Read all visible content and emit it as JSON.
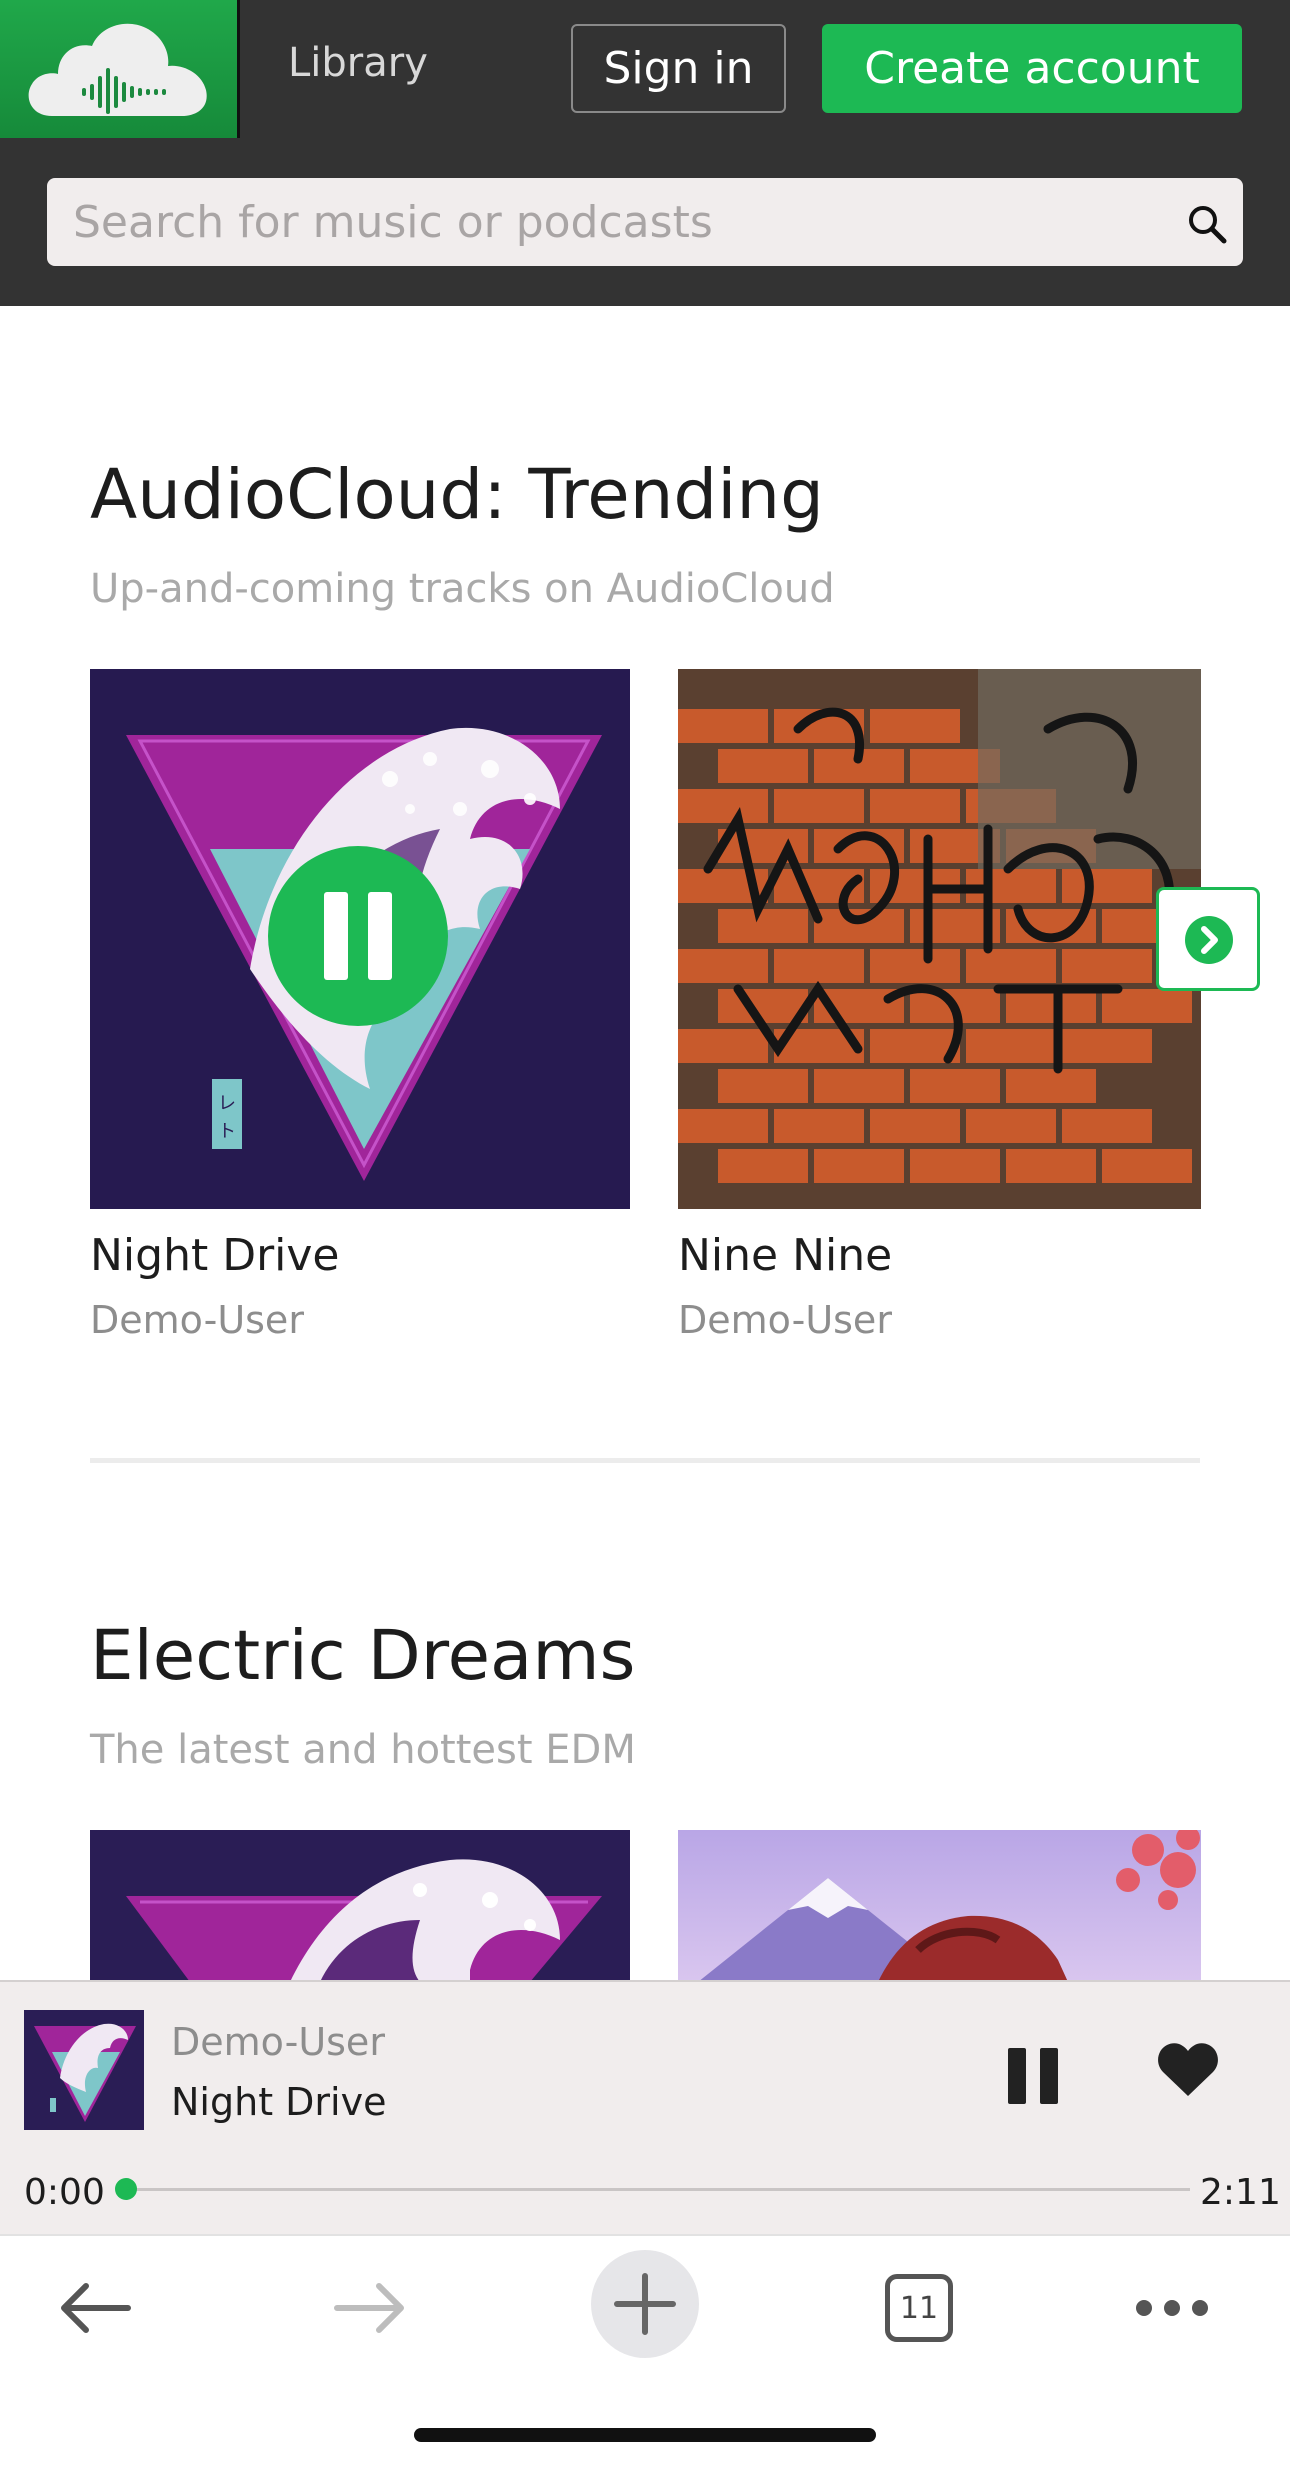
{
  "header": {
    "logo_name": "audiocloud-logo",
    "library_label": "Library",
    "signin_label": "Sign in",
    "create_account_label": "Create account",
    "search_placeholder": "Search for music or podcasts",
    "search_value": "",
    "search_icon": "search-icon"
  },
  "sections": [
    {
      "title": "AudioCloud: Trending",
      "subtitle": "Up-and-coming tracks on AudioCloud",
      "cards": [
        {
          "title": "Night Drive",
          "artist": "Demo-User",
          "art": "great-wave-triangle-artwork",
          "playing": true
        },
        {
          "title": "Nine Nine",
          "artist": "Demo-User",
          "art": "graffiti-brick-wall-artwork",
          "playing": false
        }
      ]
    },
    {
      "title": "Electric Dreams",
      "subtitle": "The latest and hottest EDM",
      "cards": [
        {
          "art": "great-wave-triangle-artwork"
        },
        {
          "art": "mountain-sky-artwork"
        }
      ]
    }
  ],
  "player": {
    "artist": "Demo-User",
    "title": "Night Drive",
    "current_time": "0:00",
    "total_time": "2:11",
    "progress": 0.0,
    "state": "playing"
  },
  "toolbar": {
    "tab_count": "11",
    "icons": [
      "back-arrow-icon",
      "forward-arrow-icon",
      "new-tab-plus-icon",
      "tabs-icon",
      "more-icon"
    ]
  },
  "colors": {
    "accent": "#1db954",
    "header_bg": "#333333",
    "player_bg": "#f1eded"
  }
}
